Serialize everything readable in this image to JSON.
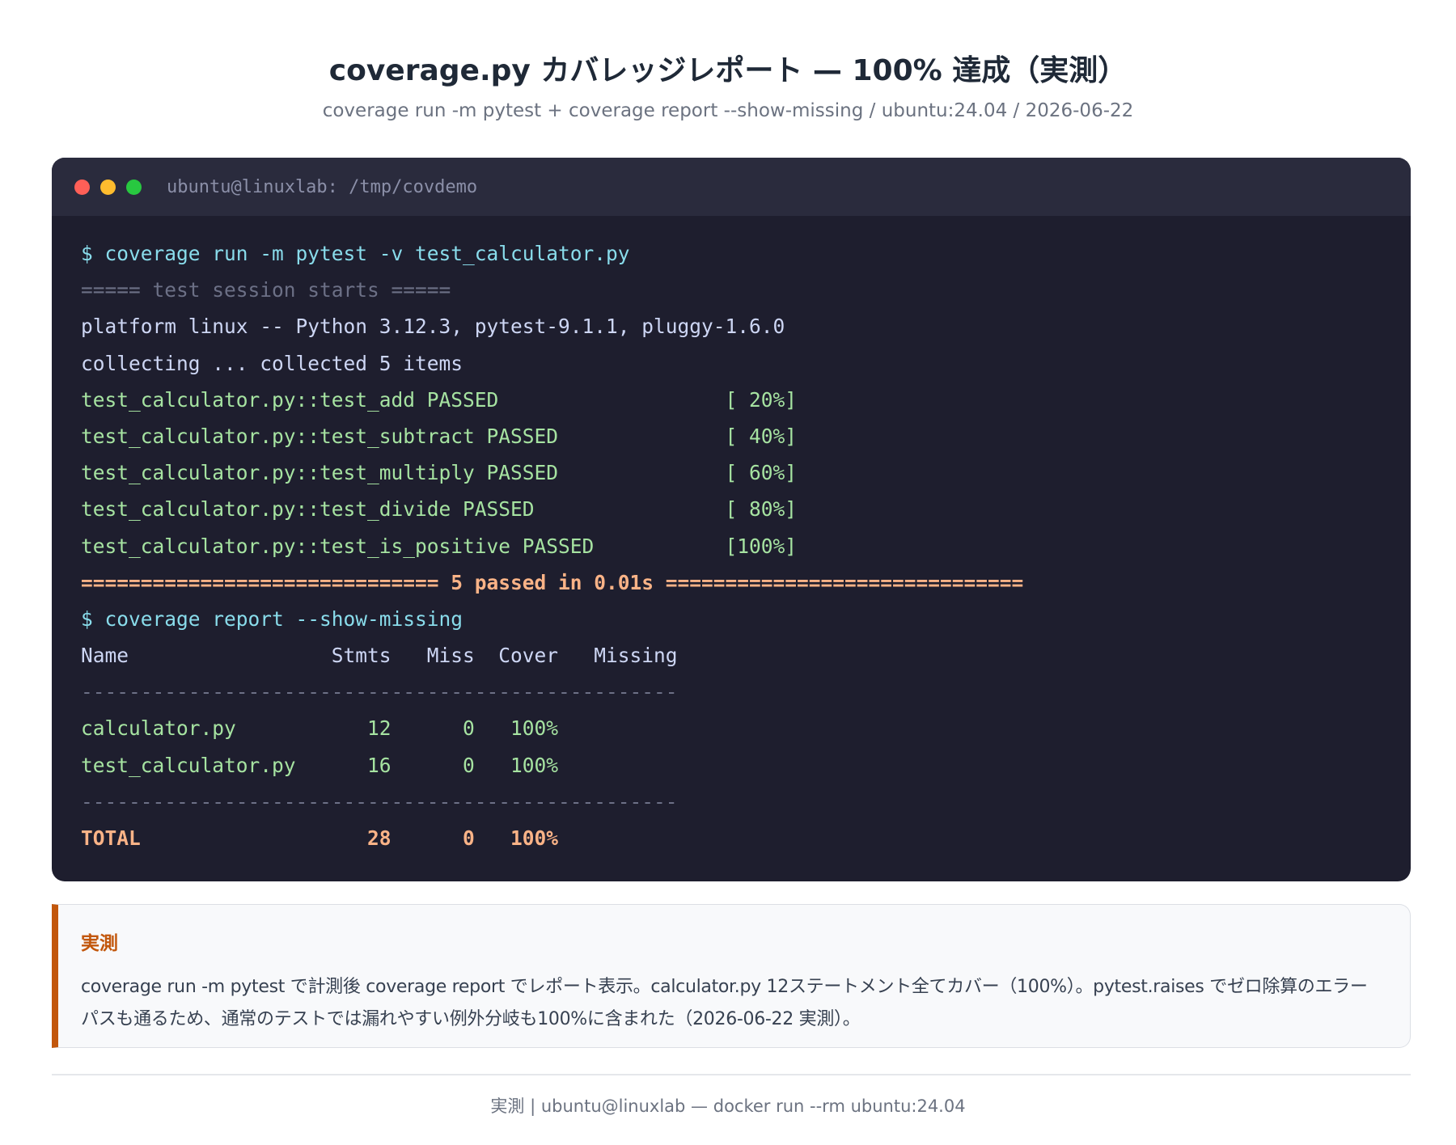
{
  "header": {
    "title": "coverage.py カバレッジレポート — 100% 達成（実測）",
    "subtitle": "coverage run -m pytest + coverage report --show-missing / ubuntu:24.04 / 2026-06-22"
  },
  "terminal": {
    "title": "ubuntu@linuxlab: /tmp/covdemo",
    "lines": [
      {
        "style": "cmd",
        "text": "$ coverage run -m pytest -v test_calculator.py"
      },
      {
        "style": "dim",
        "text": "===== test session starts ====="
      },
      {
        "style": "text",
        "text": "platform linux -- Python 3.12.3, pytest-9.1.1, pluggy-1.6.0"
      },
      {
        "style": "text",
        "text": "collecting ... collected 5 items"
      },
      {
        "style": "pass",
        "text": "test_calculator.py::test_add PASSED                   [ 20%]"
      },
      {
        "style": "pass",
        "text": "test_calculator.py::test_subtract PASSED              [ 40%]"
      },
      {
        "style": "pass",
        "text": "test_calculator.py::test_multiply PASSED              [ 60%]"
      },
      {
        "style": "pass",
        "text": "test_calculator.py::test_divide PASSED                [ 80%]"
      },
      {
        "style": "pass",
        "text": "test_calculator.py::test_is_positive PASSED           [100%]"
      },
      {
        "style": "hl",
        "text": "============================== 5 passed in 0.01s =============================="
      },
      {
        "style": "cmd",
        "text": "$ coverage report --show-missing"
      },
      {
        "style": "text",
        "text": "Name                 Stmts   Miss  Cover   Missing"
      },
      {
        "style": "dim",
        "text": "--------------------------------------------------"
      },
      {
        "style": "pass",
        "text": "calculator.py           12      0   100%"
      },
      {
        "style": "pass",
        "text": "test_calculator.py      16      0   100%"
      },
      {
        "style": "dim",
        "text": "--------------------------------------------------"
      },
      {
        "style": "hl",
        "text": "TOTAL                   28      0   100%"
      }
    ]
  },
  "note": {
    "heading": "実測",
    "body": "coverage run -m pytest で計測後 coverage report でレポート表示。calculator.py 12ステートメント全てカバー（100%）。pytest.raises でゼロ除算のエラーパスも通るため、通常のテストでは漏れやすい例外分岐も100%に含まれた（2026-06-22 実測）。"
  },
  "footer": {
    "text": "実測 | ubuntu@linuxlab — docker run --rm ubuntu:24.04"
  }
}
